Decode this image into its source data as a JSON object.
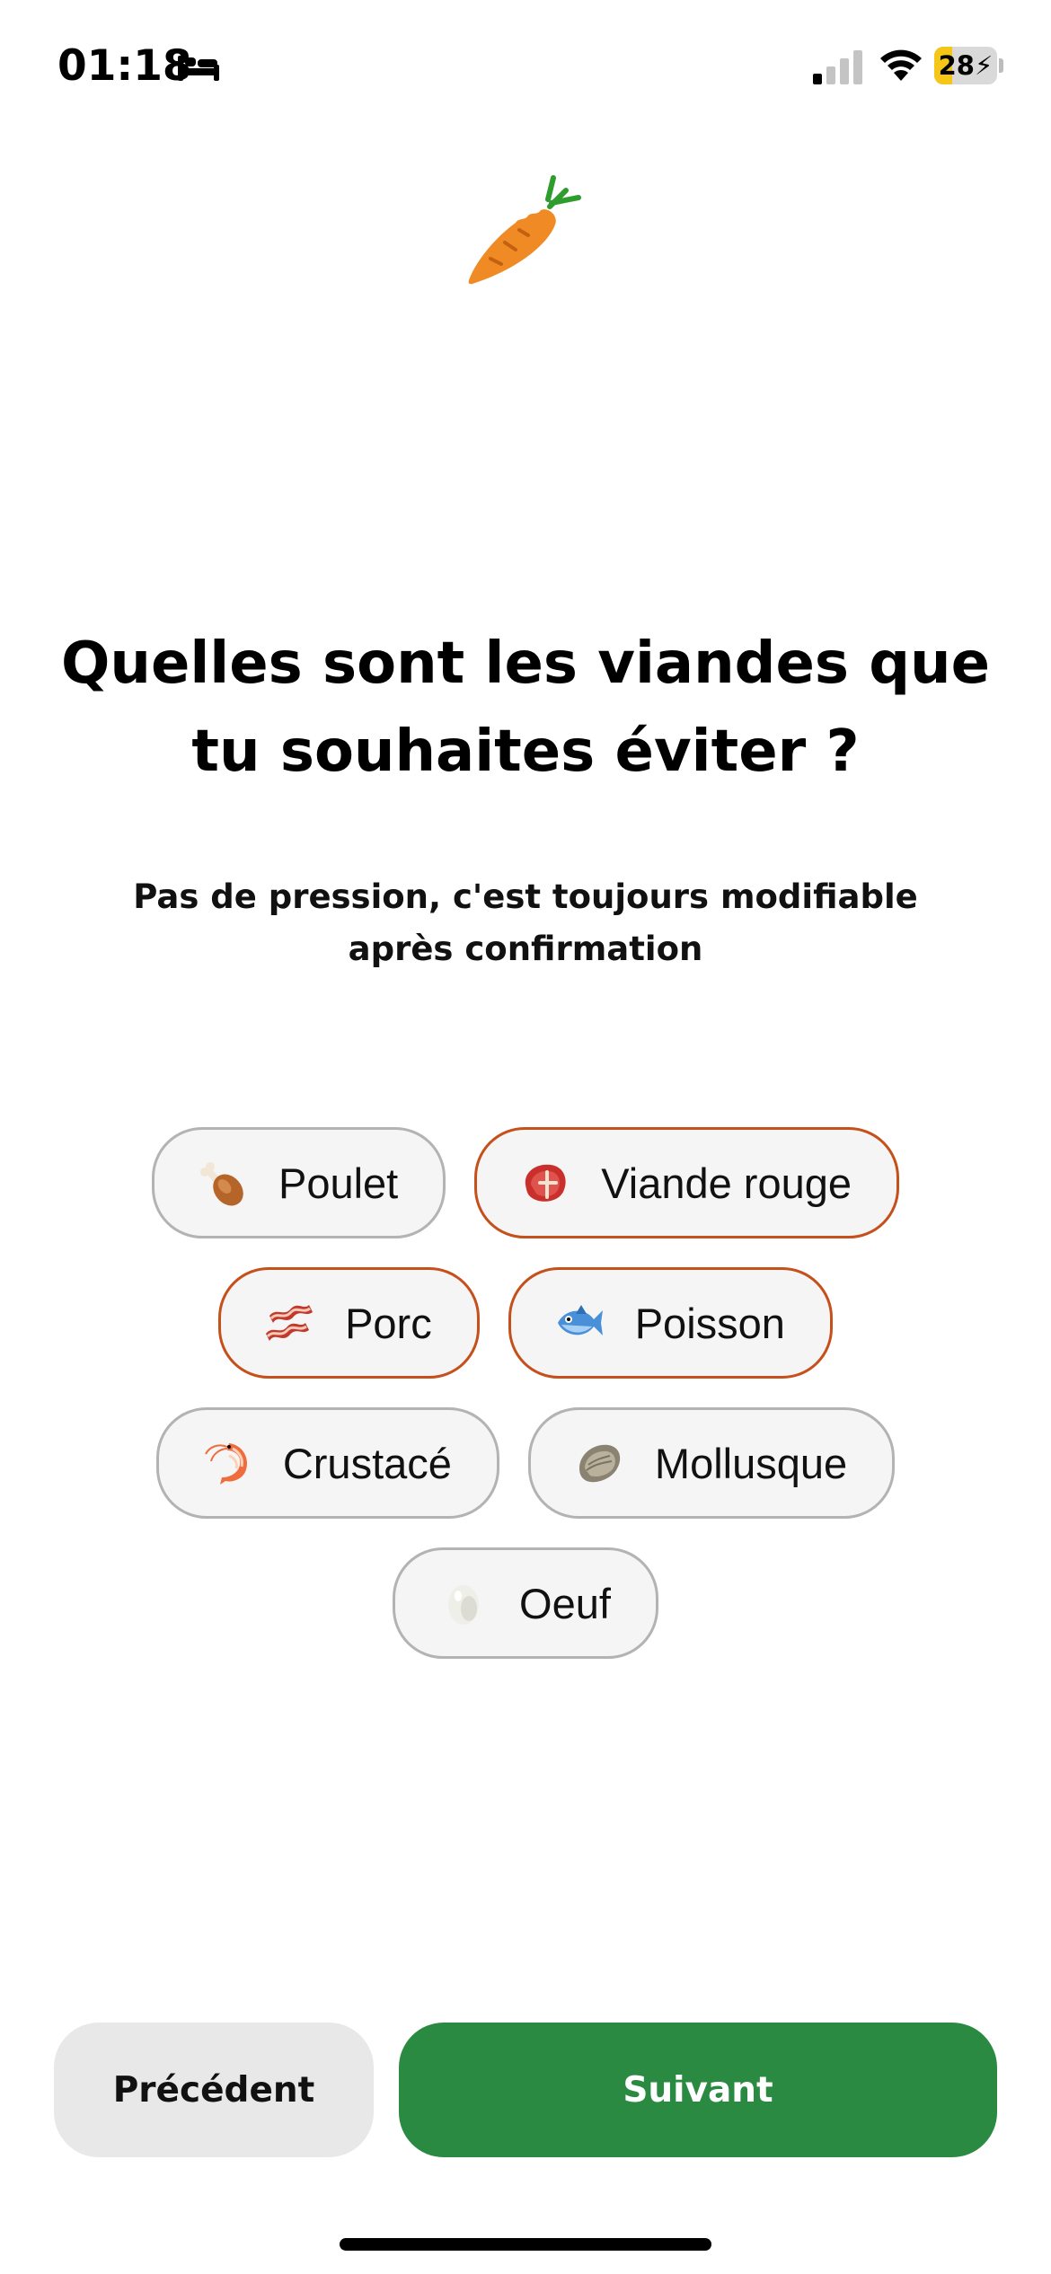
{
  "status_bar": {
    "time": "01:18",
    "battery_level": "28",
    "battery_fraction": 0.28,
    "signal_bars_active": 1,
    "signal_bars_total": 4,
    "icons": [
      "sleep-icon",
      "signal-icon",
      "wifi-icon",
      "battery-icon",
      "charging-bolt-icon"
    ]
  },
  "logo": {
    "icon": "carrot-icon"
  },
  "question": {
    "title": "Quelles sont les viandes que tu souhaites éviter ?",
    "subtitle": "Pas de pression, c'est toujours modifiable après confirmation"
  },
  "options": [
    {
      "label": "Poulet",
      "icon": "poultry-leg-icon",
      "selected": false
    },
    {
      "label": "Viande rouge",
      "icon": "cut-of-meat-icon",
      "selected": true
    },
    {
      "label": "Porc",
      "icon": "bacon-icon",
      "selected": true
    },
    {
      "label": "Poisson",
      "icon": "fish-icon",
      "selected": true
    },
    {
      "label": "Crustacé",
      "icon": "shrimp-icon",
      "selected": false
    },
    {
      "label": "Mollusque",
      "icon": "oyster-icon",
      "selected": false
    },
    {
      "label": "Oeuf",
      "icon": "egg-icon",
      "selected": false
    }
  ],
  "actions": {
    "previous_label": "Précédent",
    "next_label": "Suivant"
  },
  "colors": {
    "accent_green": "#2b8a41",
    "selected_border": "#c5501b",
    "chip_border": "#b3b3b3",
    "chip_background": "#f5f5f5",
    "secondary_button": "#e8e8e8",
    "battery_yellow": "#f5c518"
  }
}
